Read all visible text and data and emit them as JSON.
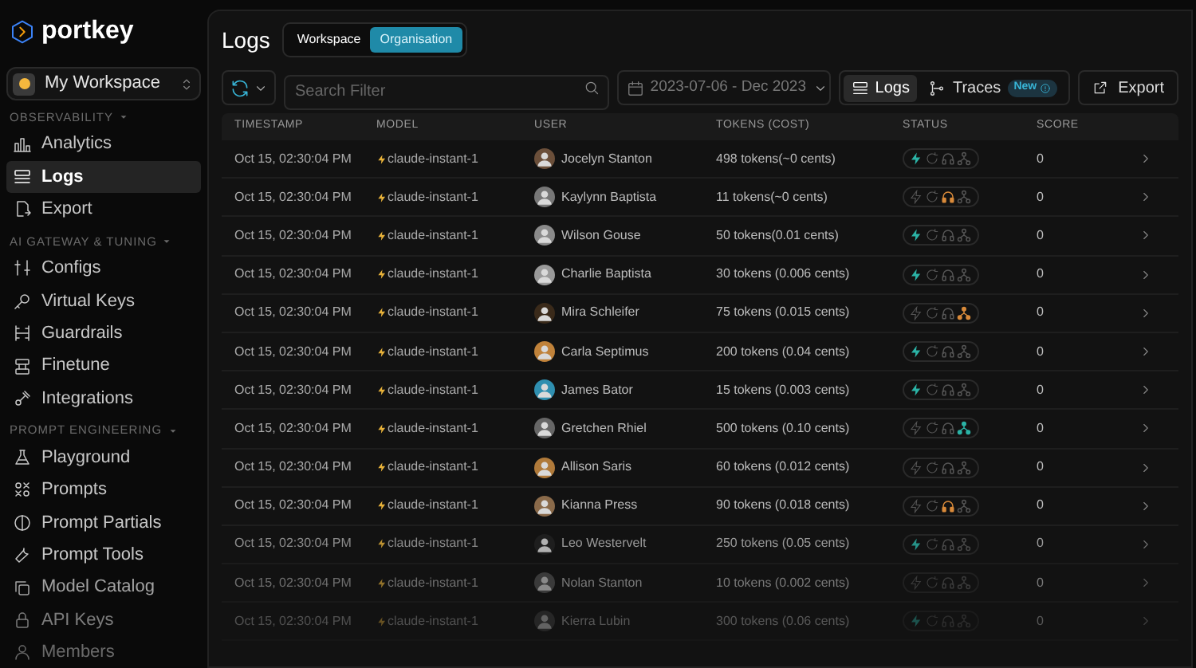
{
  "brand": {
    "name": "portkey"
  },
  "workspace": {
    "name": "My Workspace"
  },
  "sidebar": {
    "sections": [
      {
        "title": "OBSERVABILITY",
        "expanded": true,
        "items": [
          {
            "label": "Analytics",
            "selected": false
          },
          {
            "label": "Logs",
            "selected": true
          },
          {
            "label": "Export",
            "selected": false
          }
        ]
      },
      {
        "title": "AI GATEWAY & TUNING",
        "expanded": true,
        "items": [
          {
            "label": "Configs",
            "selected": false
          },
          {
            "label": "Virtual Keys",
            "selected": false
          },
          {
            "label": "Guardrails",
            "selected": false
          },
          {
            "label": "Finetune",
            "selected": false
          },
          {
            "label": "Integrations",
            "selected": false
          }
        ]
      },
      {
        "title": "PROMPT ENGINEERING",
        "expanded": true,
        "items": [
          {
            "label": "Playground",
            "selected": false
          },
          {
            "label": "Prompts",
            "selected": false
          },
          {
            "label": "Prompt Partials",
            "selected": false
          },
          {
            "label": "Prompt Tools",
            "selected": false
          },
          {
            "label": "Model Catalog",
            "selected": false
          },
          {
            "label": "API Keys",
            "selected": false
          },
          {
            "label": "Members",
            "selected": false
          }
        ]
      }
    ]
  },
  "page": {
    "title": "Logs",
    "scope_tabs": [
      {
        "label": "Workspace",
        "selected": false
      },
      {
        "label": "Organisation",
        "selected": true
      }
    ]
  },
  "toolbar": {
    "search": {
      "placeholder": "Search Filter"
    },
    "date_range": "2023-07-06 - Dec 2023",
    "view_tabs": [
      {
        "label": "Logs",
        "selected": true
      },
      {
        "label": "Traces",
        "selected": false,
        "badge": "New"
      }
    ],
    "export": "Export"
  },
  "table": {
    "columns": [
      "TIMESTAMP",
      "MODEL",
      "USER",
      "TOKENS (COST)",
      "STATUS",
      "SCORE"
    ],
    "rows": [
      {
        "timestamp": "Oct 15, 02:30:04 PM",
        "model": "claude-instant-1",
        "user": "Jocelyn Stanton",
        "tokens": "498 tokens(~0 cents)",
        "cache_hit": true,
        "feedback": false,
        "trace_success": false,
        "trace_warning": false,
        "score": "0"
      },
      {
        "timestamp": "Oct 15, 02:30:04 PM",
        "model": "claude-instant-1",
        "user": "Kaylynn Baptista",
        "tokens": "11 tokens(~0 cents)",
        "cache_hit": false,
        "feedback": true,
        "trace_success": false,
        "trace_warning": false,
        "score": "0"
      },
      {
        "timestamp": "Oct 15, 02:30:04 PM",
        "model": "claude-instant-1",
        "user": "Wilson Gouse",
        "tokens": "50 tokens(0.01 cents)",
        "cache_hit": true,
        "feedback": false,
        "trace_success": false,
        "trace_warning": false,
        "score": "0"
      },
      {
        "timestamp": "Oct 15, 02:30:04 PM",
        "model": "claude-instant-1",
        "user": "Charlie Baptista",
        "tokens": "30 tokens (0.006 cents)",
        "cache_hit": true,
        "feedback": false,
        "trace_success": false,
        "trace_warning": false,
        "score": "0"
      },
      {
        "timestamp": "Oct 15, 02:30:04 PM",
        "model": "claude-instant-1",
        "user": "Mira Schleifer",
        "tokens": "75 tokens (0.015 cents)",
        "cache_hit": false,
        "feedback": false,
        "trace_success": false,
        "trace_warning": true,
        "score": "0"
      },
      {
        "timestamp": "Oct 15, 02:30:04 PM",
        "model": "claude-instant-1",
        "user": "Carla Septimus",
        "tokens": "200 tokens (0.04 cents)",
        "cache_hit": true,
        "feedback": false,
        "trace_success": false,
        "trace_warning": false,
        "score": "0"
      },
      {
        "timestamp": "Oct 15, 02:30:04 PM",
        "model": "claude-instant-1",
        "user": "James Bator",
        "tokens": "15 tokens (0.003 cents)",
        "cache_hit": true,
        "feedback": false,
        "trace_success": false,
        "trace_warning": false,
        "score": "0"
      },
      {
        "timestamp": "Oct 15, 02:30:04 PM",
        "model": "claude-instant-1",
        "user": "Gretchen Rhiel",
        "tokens": "500 tokens (0.10 cents)",
        "cache_hit": false,
        "feedback": false,
        "trace_success": true,
        "trace_warning": false,
        "score": "0"
      },
      {
        "timestamp": "Oct 15, 02:30:04 PM",
        "model": "claude-instant-1",
        "user": "Allison Saris",
        "tokens": "60 tokens (0.012 cents)",
        "cache_hit": false,
        "feedback": false,
        "trace_success": false,
        "trace_warning": false,
        "score": "0"
      },
      {
        "timestamp": "Oct 15, 02:30:04 PM",
        "model": "claude-instant-1",
        "user": "Kianna Press",
        "tokens": "90 tokens (0.018 cents)",
        "cache_hit": false,
        "feedback": true,
        "trace_success": false,
        "trace_warning": false,
        "score": "0"
      },
      {
        "timestamp": "Oct 15, 02:30:04 PM",
        "model": "claude-instant-1",
        "user": "Leo Westervelt",
        "tokens": "250 tokens (0.05 cents)",
        "cache_hit": true,
        "feedback": false,
        "trace_success": false,
        "trace_warning": false,
        "score": "0"
      },
      {
        "timestamp": "Oct 15, 02:30:04 PM",
        "model": "claude-instant-1",
        "user": "Nolan Stanton",
        "tokens": "10 tokens (0.002 cents)",
        "cache_hit": false,
        "feedback": false,
        "trace_success": false,
        "trace_warning": false,
        "score": "0"
      },
      {
        "timestamp": "Oct 15, 02:30:04 PM",
        "model": "claude-instant-1",
        "user": "Kierra Lubin",
        "tokens": "300 tokens (0.06 cents)",
        "cache_hit": true,
        "feedback": false,
        "trace_success": false,
        "trace_warning": false,
        "score": "0"
      }
    ]
  }
}
